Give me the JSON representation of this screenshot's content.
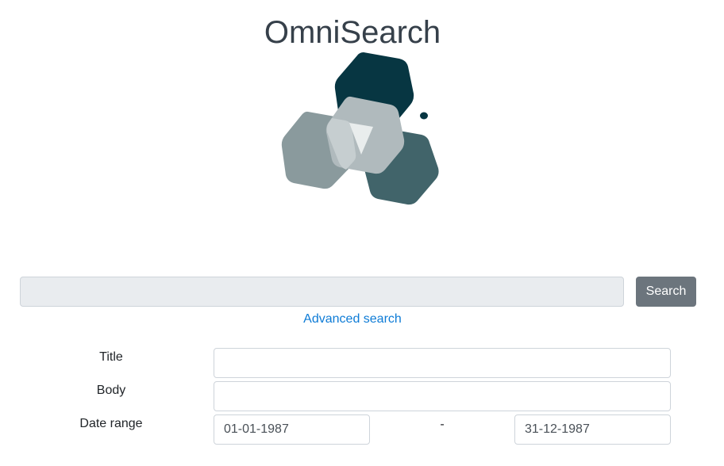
{
  "header": {
    "app_title": "OmniSearch"
  },
  "logo": {
    "icon": "hexagon-cluster-logo",
    "colors": {
      "dark": "#073642",
      "medium": "#41646a",
      "light": "#8a9a9d",
      "pale": "#c6ced0"
    }
  },
  "search": {
    "query_value": "",
    "button_label": "Search",
    "button_color": "#6c757d",
    "advanced_link_label": "Advanced search",
    "link_color": "#0d7bd6"
  },
  "advanced": {
    "title_label": "Title",
    "title_value": "",
    "body_label": "Body",
    "body_value": "",
    "date_range_label": "Date range",
    "date_from": "01-01-1987",
    "date_separator": "-",
    "date_to": "31-12-1987"
  }
}
